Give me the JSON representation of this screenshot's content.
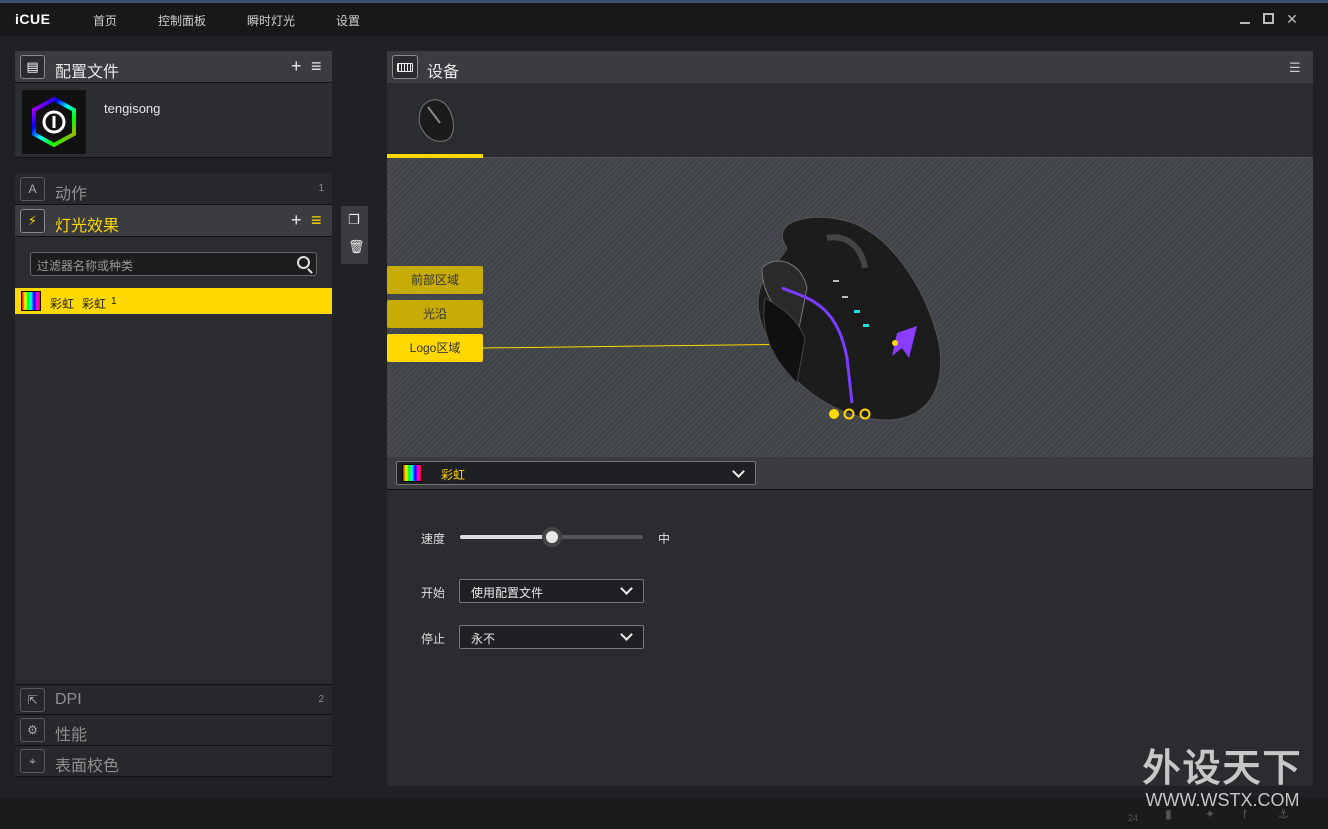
{
  "app": {
    "title": "iCUE"
  },
  "nav": {
    "home": "首页",
    "dashboard": "控制面板",
    "instant_lighting": "瞬时灯光",
    "settings": "设置"
  },
  "profiles": {
    "title": "配置文件",
    "name": "tengisong"
  },
  "actions": {
    "title": "动作",
    "count": "1"
  },
  "lighting": {
    "title": "灯光效果",
    "filter_placeholder": "过滤器名称或种类",
    "item": {
      "type": "彩虹",
      "name": "彩虹",
      "count": "1"
    }
  },
  "dpi": {
    "title": "DPI",
    "count": "2"
  },
  "performance": {
    "title": "性能"
  },
  "calibration": {
    "title": "表面校色"
  },
  "devices": {
    "title": "设备"
  },
  "zones": [
    "前部区域",
    "光沿",
    "Logo区域"
  ],
  "colors": {
    "accent": "#ffd800",
    "zone_inactive": "#c7ac06"
  },
  "effect": {
    "selected": "彩虹"
  },
  "speed": {
    "label": "速度",
    "value_label": "中",
    "level": 0.5
  },
  "start": {
    "label": "开始",
    "value": "使用配置文件"
  },
  "stop": {
    "label": "停止",
    "value": "永不"
  },
  "watermark": {
    "brand": "外设天下",
    "url": "WWW.WSTX.COM"
  },
  "footer": {
    "count": "24"
  }
}
